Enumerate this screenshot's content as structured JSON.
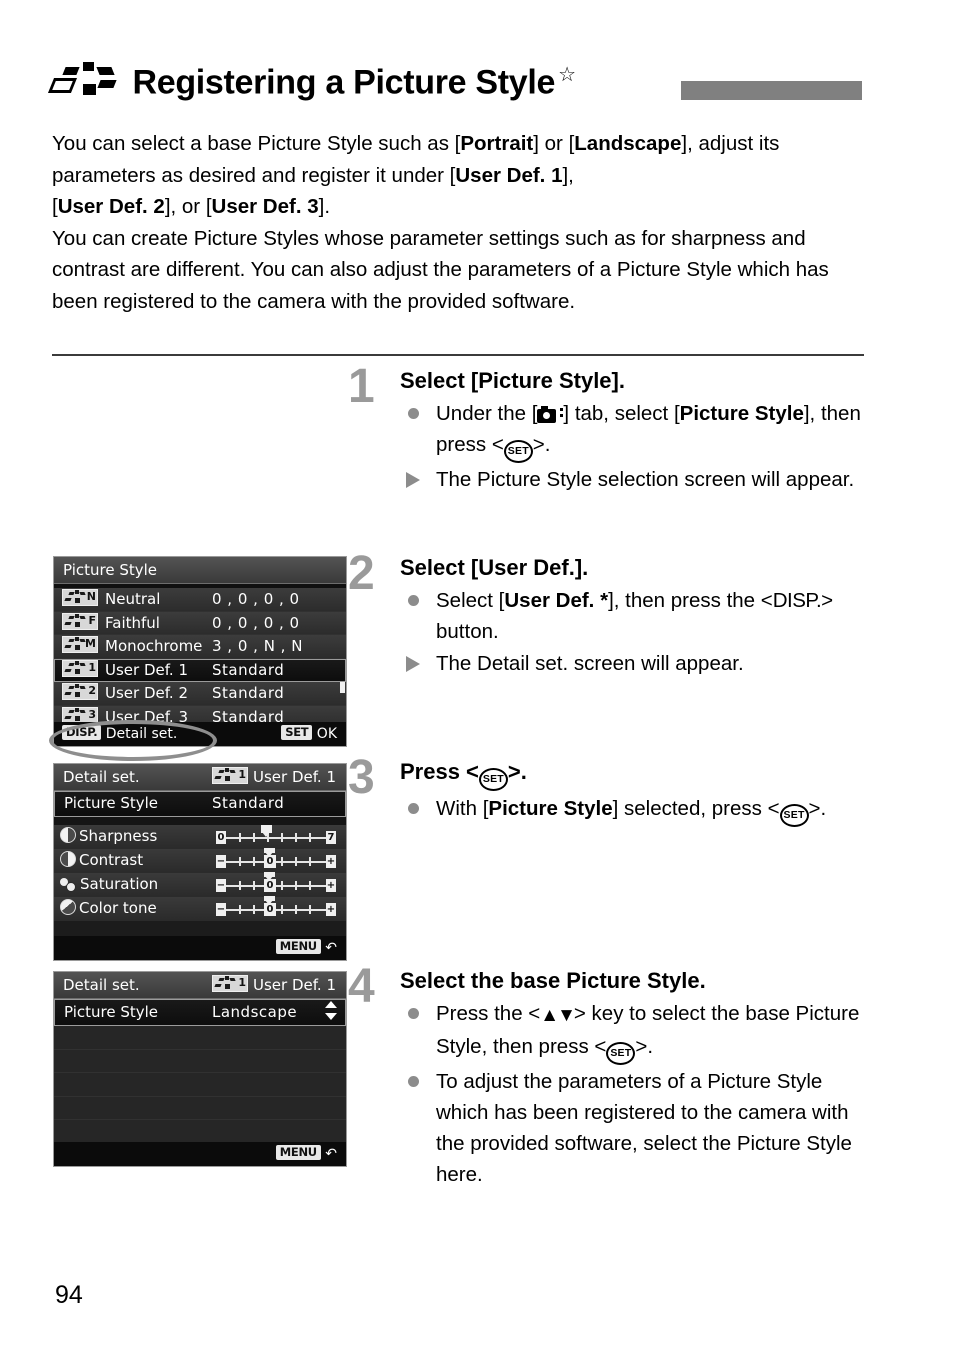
{
  "header": {
    "icon": "picture-style-icon",
    "title": "Registering a Picture Style",
    "star": "☆"
  },
  "intro": {
    "line1_a": "You can select a base Picture Style such as [",
    "portrait": "Portrait",
    "line1_b": "] or [",
    "landscape": "Landscape",
    "line1_c": "],",
    "line2_a": "adjust its parameters as desired and register it under [",
    "userdef1": "User Def. 1",
    "line2_b": "],",
    "line3_a": "[",
    "userdef2": "User Def. 2",
    "line3_b": "], or [",
    "userdef3": "User Def. 3",
    "line3_c": "].",
    "paragraph2": "You can create Picture Styles whose parameter settings such as for sharpness and contrast are different. You can also adjust the parameters of a Picture Style which has been registered to the camera with the provided software."
  },
  "steps": [
    {
      "number": "1",
      "title": "Select [Picture Style].",
      "items": [
        {
          "marker": "bullet",
          "pre": "Under the [",
          "icon": "camera-menu-tab-icon",
          "mid": "] tab, select [",
          "bold": "Picture Style",
          "mid2": "], then press <",
          "key": "SET",
          "post": ">."
        },
        {
          "marker": "triangle",
          "text": "The Picture Style selection screen will appear."
        }
      ]
    },
    {
      "number": "2",
      "title": "Select [User Def.].",
      "items": [
        {
          "marker": "bullet",
          "pre": "Select [",
          "bold": "User Def. *",
          "mid": "], then press the <",
          "key": "DISP.",
          "post": "> button."
        },
        {
          "marker": "triangle",
          "text": "The Detail set. screen will appear."
        }
      ]
    },
    {
      "number": "3",
      "title_pre": "Press <",
      "title_key": "SET",
      "title_post": ">.",
      "number_label": "3",
      "items": [
        {
          "marker": "bullet",
          "pre": "With [",
          "bold": "Picture Style",
          "mid": "] selected, press <",
          "key": "SET",
          "post": ">."
        }
      ]
    },
    {
      "number": "4",
      "title": "Select the base Picture Style.",
      "items": [
        {
          "marker": "bullet",
          "pre": "Press the <",
          "key": "▲▼",
          "mid": "> key to select the base Picture Style, then press <",
          "key2": "SET",
          "post": ">."
        },
        {
          "marker": "bullet",
          "text": "To adjust the parameters of a Picture Style which has been registered to the camera with the provided software, select the Picture Style here."
        }
      ]
    }
  ],
  "screens": {
    "list": {
      "title": "Picture Style",
      "rows": [
        {
          "badge": "N",
          "label": "Neutral",
          "value": "0 , 0 , 0 , 0",
          "selected": false
        },
        {
          "badge": "F",
          "label": "Faithful",
          "value": "0 , 0 , 0 , 0",
          "selected": false
        },
        {
          "badge": "M",
          "label": "Monochrome",
          "value": "3 , 0 , N , N",
          "selected": false
        },
        {
          "badge": "1",
          "label": "User Def. 1",
          "value": "Standard",
          "selected": true
        },
        {
          "badge": "2",
          "label": "User Def. 2",
          "value": "Standard",
          "selected": false
        },
        {
          "badge": "3",
          "label": "User Def. 3",
          "value": "Standard",
          "selected": false
        }
      ],
      "bottom_left_tag": "DISP.",
      "bottom_left_label": "Detail set.",
      "bottom_right_tag": "SET",
      "bottom_right_label": "OK"
    },
    "detail": {
      "title": "Detail set.",
      "title_badge": "1",
      "title_right": "User Def. 1",
      "picture_style_label": "Picture Style",
      "picture_style_value": "Standard",
      "params": [
        {
          "icon": "sharpness-icon",
          "label": "Sharpness",
          "min_cap": "0",
          "max_cap": "7",
          "pointer": 3,
          "value_label": ""
        },
        {
          "icon": "contrast-icon",
          "label": "Contrast",
          "min_cap": "−",
          "max_cap": "+",
          "pointer": 4,
          "value_label": "0"
        },
        {
          "icon": "saturation-icon",
          "label": "Saturation",
          "min_cap": "−",
          "max_cap": "+",
          "pointer": 4,
          "value_label": "0"
        },
        {
          "icon": "color-tone-icon",
          "label": "Color tone",
          "min_cap": "−",
          "max_cap": "+",
          "pointer": 4,
          "value_label": "0"
        }
      ],
      "bottom_right_tag": "MENU",
      "bottom_right_label": "↶"
    },
    "base": {
      "title": "Detail set.",
      "title_badge": "1",
      "title_right": "User Def. 1",
      "picture_style_label": "Picture Style",
      "picture_style_value": "Landscape",
      "bottom_right_tag": "MENU",
      "bottom_right_label": "↶"
    }
  },
  "page_number": "94"
}
